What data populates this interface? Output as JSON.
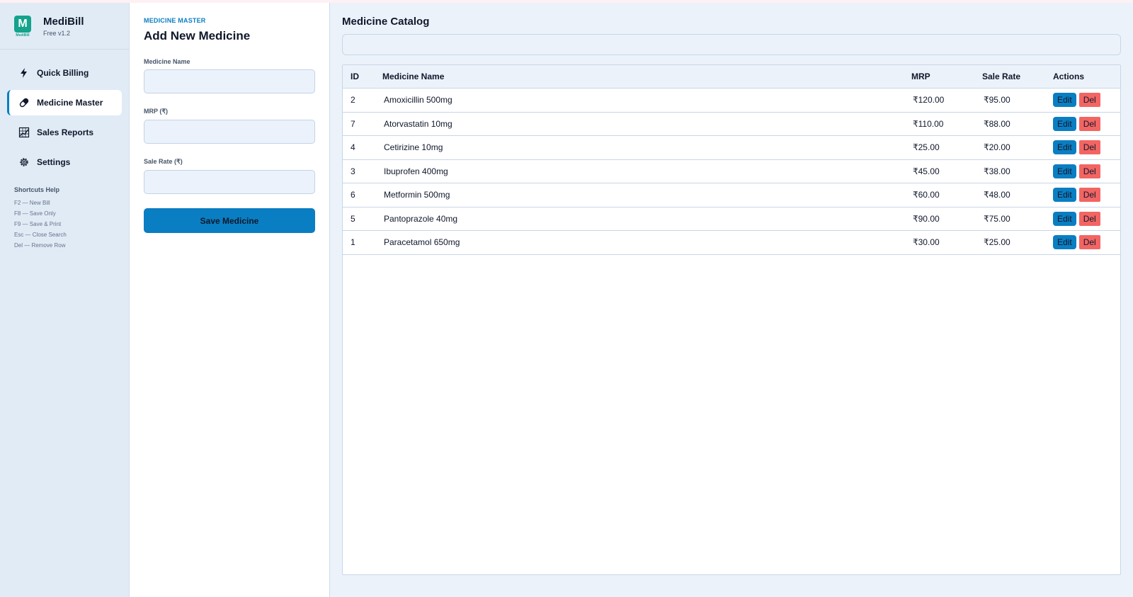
{
  "brand": {
    "name": "MediBill",
    "version": "Free v1.2",
    "logo_letter": "M",
    "logo_caption": "MediBill"
  },
  "nav": {
    "items": [
      {
        "label": "Quick Billing",
        "icon": "bolt-icon",
        "active": false
      },
      {
        "label": "Medicine Master",
        "icon": "pill-icon",
        "active": true
      },
      {
        "label": "Sales Reports",
        "icon": "chart-icon",
        "active": false
      },
      {
        "label": "Settings",
        "icon": "gear-icon",
        "active": false
      }
    ]
  },
  "shortcuts": {
    "header": "Shortcuts Help",
    "items": [
      "F2  — New Bill",
      "F8  — Save Only",
      "F9  — Save & Print",
      "Esc — Close Search",
      "Del — Remove Row"
    ]
  },
  "form": {
    "eyebrow": "MEDICINE MASTER",
    "title": "Add New Medicine",
    "name_label": "Medicine Name",
    "name_value": "",
    "mrp_label": "MRP (₹)",
    "mrp_value": "",
    "sale_label": "Sale Rate (₹)",
    "sale_value": "",
    "save_label": "Save Medicine"
  },
  "catalog": {
    "title": "Medicine Catalog",
    "search_value": "",
    "columns": [
      "ID",
      "Medicine Name",
      "MRP",
      "Sale Rate",
      "Actions"
    ],
    "edit_label": "Edit",
    "del_label": "Del",
    "rows": [
      {
        "id": "2",
        "name": "Amoxicillin 500mg",
        "mrp": "₹120.00",
        "sale": "₹95.00"
      },
      {
        "id": "7",
        "name": "Atorvastatin 10mg",
        "mrp": "₹110.00",
        "sale": "₹88.00"
      },
      {
        "id": "4",
        "name": "Cetirizine 10mg",
        "mrp": "₹25.00",
        "sale": "₹20.00"
      },
      {
        "id": "3",
        "name": "Ibuprofen 400mg",
        "mrp": "₹45.00",
        "sale": "₹38.00"
      },
      {
        "id": "6",
        "name": "Metformin 500mg",
        "mrp": "₹60.00",
        "sale": "₹48.00"
      },
      {
        "id": "5",
        "name": "Pantoprazole 40mg",
        "mrp": "₹90.00",
        "sale": "₹75.00"
      },
      {
        "id": "1",
        "name": "Paracetamol 650mg",
        "mrp": "₹30.00",
        "sale": "₹25.00"
      }
    ]
  },
  "colors": {
    "accent": "#0a7ec2",
    "danger": "#f26563",
    "brand": "#14a38b",
    "sidebar_bg": "#e1ebf6",
    "main_bg": "#ecf2fa"
  }
}
